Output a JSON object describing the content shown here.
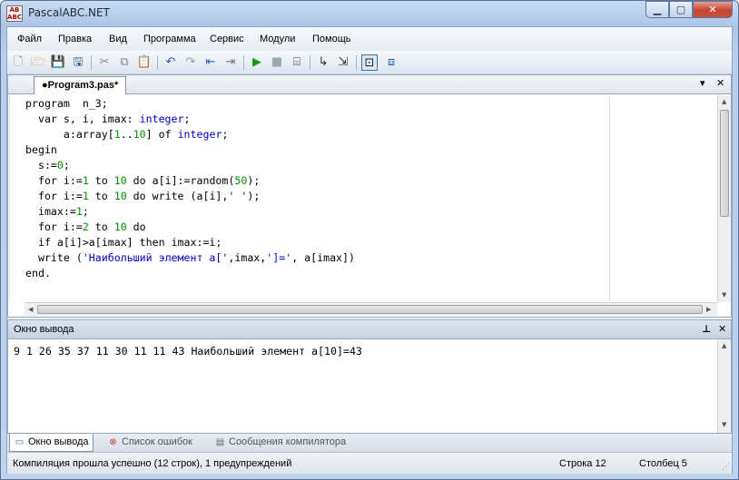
{
  "window": {
    "title": "PascalABC.NET",
    "minimize_label": "▁",
    "maximize_label": "▢",
    "close_label": "✕"
  },
  "menu": [
    "Файл",
    "Правка",
    "Вид",
    "Программа",
    "Сервис",
    "Модули",
    "Помощь"
  ],
  "toolbar_icons": [
    "new-file-icon",
    "open-folder-icon",
    "save-icon",
    "save-all-icon",
    "cut-icon",
    "copy-icon",
    "paste-icon",
    "undo-icon",
    "redo-icon",
    "find-icon",
    "replace-icon",
    "run-icon",
    "stop-icon",
    "compile-icon",
    "step-over-icon",
    "step-into-icon",
    "output-window-icon",
    "debug-icon"
  ],
  "editor": {
    "tab_label": "●Program3.pas*",
    "tab_dropdown": "▾",
    "tab_close": "✕",
    "code_lines": [
      "program  n_3;",
      "  var s, i, imax: integer;",
      "      a:array[1..10] of integer;",
      "begin",
      "  s:=0;",
      "  for i:=1 to 10 do a[i]:=random(50);",
      "  for i:=1 to 10 do write (a[i],' ');",
      "  imax:=1;",
      "  for i:=2 to 10 do",
      "  if a[i]>a[imax] then imax:=i;",
      "  write ('Наибольший элемент a[',imax,']=', a[imax])",
      "end."
    ]
  },
  "output_panel": {
    "title": "Окно вывода",
    "pin_label": "⊥",
    "close_label": "✕",
    "text": "9 1 26 35 37 11 30 11 11 43 Наибольший элемент a[10]=43"
  },
  "bottom_tabs": [
    {
      "label": "Окно вывода",
      "icon": "output-window-icon",
      "active": true
    },
    {
      "label": "Список ошибок",
      "icon": "error-list-icon",
      "active": false
    },
    {
      "label": "Сообщения компилятора",
      "icon": "compiler-messages-icon",
      "active": false
    }
  ],
  "status": {
    "message": "Компиляция прошла успешно (12 строк), 1 предупреждений",
    "row": "Строка  12",
    "column": "Столбец  5"
  }
}
